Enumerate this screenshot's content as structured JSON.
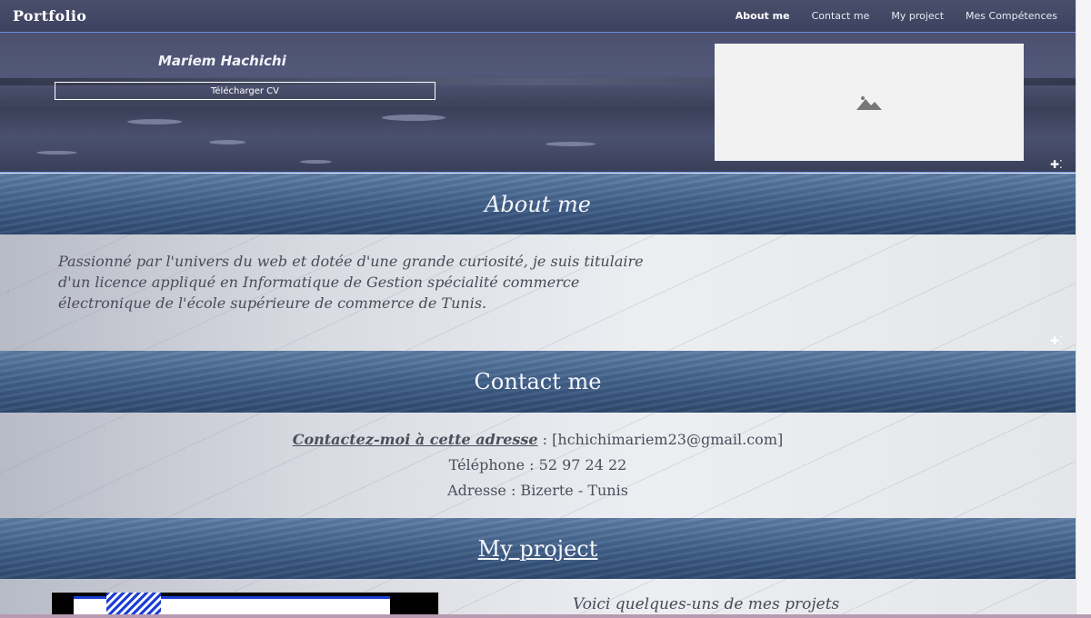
{
  "navbar": {
    "brand": "Portfolio",
    "links": [
      "About me",
      "Contact me",
      "My project",
      "Mes Compétences"
    ]
  },
  "hero": {
    "name": "Mariem Hachichi",
    "cv_button": "Télécharger CV",
    "image_icon": "image-placeholder-icon"
  },
  "about": {
    "title": "About me",
    "text": "Passionné par l'univers du web et dotée d'une grande curiosité, je suis titulaire d'un licence appliqué en Informatique de Gestion spécialité  commerce électronique de l'école supérieure de commerce de Tunis."
  },
  "contact": {
    "title": "Contact me",
    "link_label": "Contactez-moi à cette adresse",
    "email": " : [hchichimariem23@gmail.com]",
    "phone": "Téléphone : 52 97 24 22",
    "address": "Adresse : Bizerte - Tunis"
  },
  "project": {
    "title": "My project",
    "intro": "Voici quelques-uns de mes projets"
  },
  "colors": {
    "nav_bg": "#3c4160",
    "band_blue": "#41608a",
    "accent_border": "#6b8fe0"
  }
}
